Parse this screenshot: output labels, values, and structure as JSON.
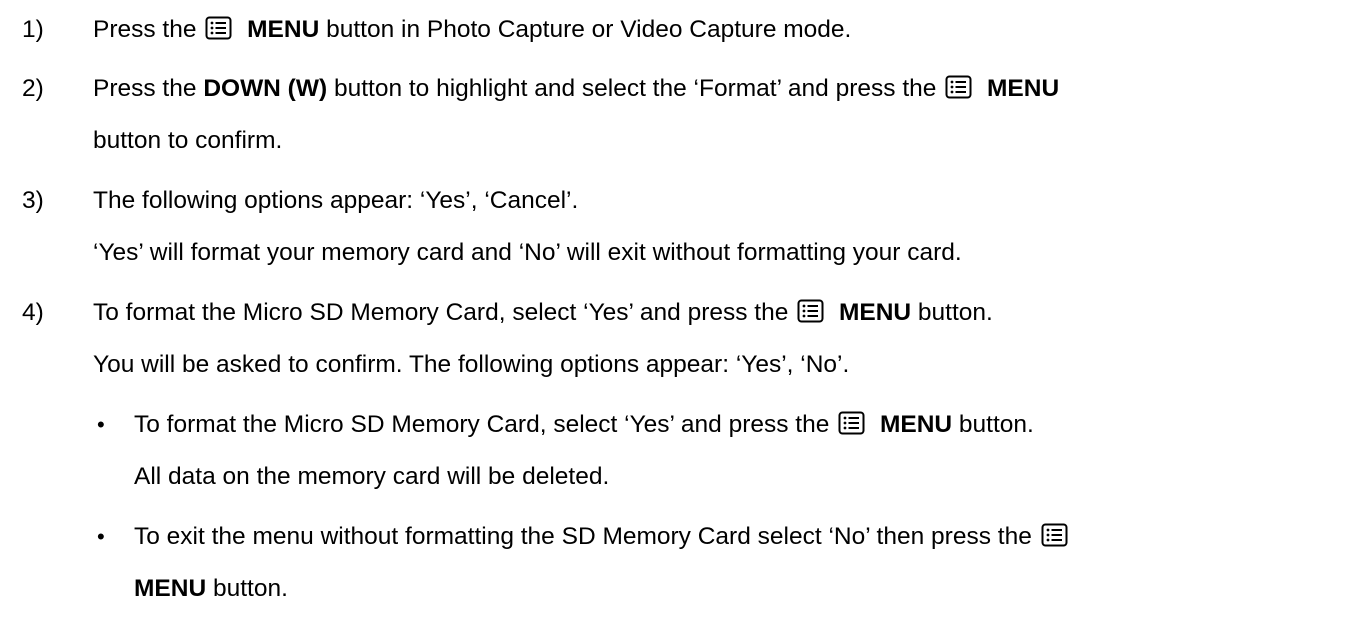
{
  "steps": [
    {
      "number": "1)",
      "pre": "Press the",
      "key": "MENU",
      "post": "button in Photo Capture or Video Capture mode."
    },
    {
      "number": "2)",
      "pre": "Press the",
      "key": "DOWN (W)",
      "mid": "button to highlight and select the ‘Format’ and press the",
      "key2": "MENU",
      "cont": "button to confirm."
    },
    {
      "number": "3)",
      "line1": "The following options appear: ‘Yes’, ‘Cancel’.",
      "line2": "‘Yes’ will format your memory card and ‘No’ will exit without formatting your card."
    },
    {
      "number": "4)",
      "pre": "To format the Micro SD Memory Card, select ‘Yes’ and press the",
      "key": "MENU",
      "post": "button.",
      "line2": "You will be asked to confirm. The following options appear: ‘Yes’, ‘No’.",
      "bullets": [
        {
          "pre": "To format the Micro SD Memory Card, select ‘Yes’ and press the",
          "key": "MENU",
          "post": "button.",
          "line2": "All data on the memory card will be deleted."
        },
        {
          "pre": "To exit the menu without formatting the SD Memory Card select ‘No’ then press the",
          "key": "MENU",
          "post": "button."
        }
      ]
    }
  ],
  "icon": "menu-list-icon",
  "bullet_glyph": "•"
}
